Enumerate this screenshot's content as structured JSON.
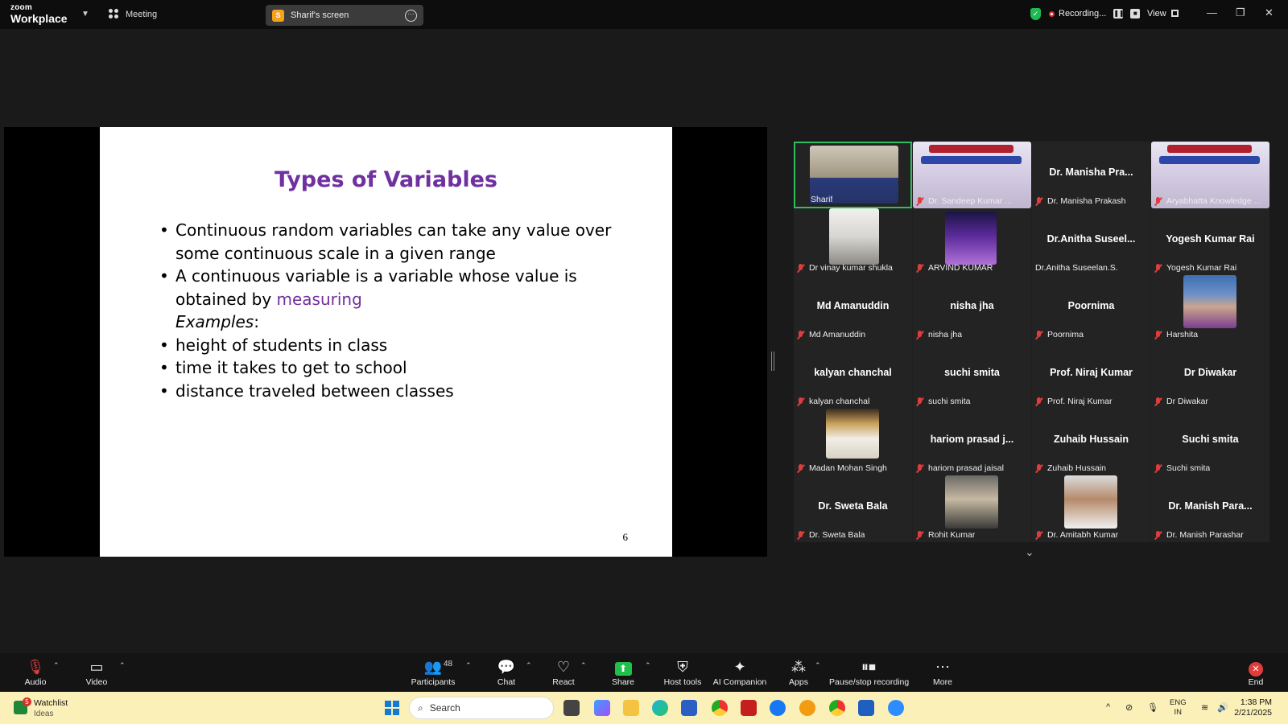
{
  "app": {
    "brand_top": "zoom",
    "brand_bottom": "Workplace",
    "meeting_label": "Meeting",
    "share_letter": "S",
    "share_title": "Sharif's screen",
    "recording_label": "Recording...",
    "view_label": "View"
  },
  "slide": {
    "title": "Types of Variables",
    "line1": "Continuous random variables can take any value over some continuous scale in a given range",
    "line2_prefix": "A continuous variable is a variable whose value is obtained by",
    "line2_highlight": "measuring",
    "examples_label": "Examples",
    "examples_colon": ":",
    "example1": "height of students in class",
    "example2": "time it takes to get to school",
    "example3": "distance traveled between classes",
    "page_number": "6"
  },
  "gallery": {
    "tiles": [
      {
        "label": "Sharif"
      },
      {
        "label": "Dr. Sandeep Kumar ..."
      },
      {
        "name": "Dr. Manisha Pra...",
        "label": "Dr. Manisha Prakash"
      },
      {
        "label": "Aryabhatta Knowledge ..."
      },
      {
        "label": "Dr vinay kumar shukla"
      },
      {
        "label": "ARVIND KUMAR"
      },
      {
        "name": "Dr.Anitha Suseel...",
        "label": "Dr.Anitha Suseelan.S."
      },
      {
        "name": "Yogesh Kumar Rai",
        "label": "Yogesh Kumar Rai"
      },
      {
        "name": "Md Amanuddin",
        "label": "Md Amanuddin"
      },
      {
        "name": "nisha jha",
        "label": "nisha jha"
      },
      {
        "name": "Poornima",
        "label": "Poornima"
      },
      {
        "label": "Harshita"
      },
      {
        "name": "kalyan chanchal",
        "label": "kalyan chanchal"
      },
      {
        "name": "suchi smita",
        "label": "suchi smita"
      },
      {
        "name": "Prof. Niraj Kumar",
        "label": "Prof. Niraj Kumar"
      },
      {
        "name": "Dr Diwakar",
        "label": "Dr Diwakar"
      },
      {
        "label": "Madan Mohan Singh"
      },
      {
        "name": "hariom prasad j...",
        "label": "hariom prasad jaisal"
      },
      {
        "name": "Zuhaib Hussain",
        "label": "Zuhaib Hussain"
      },
      {
        "name": "Suchi smita",
        "label": "Suchi smita"
      },
      {
        "name": "Dr. Sweta Bala",
        "label": "Dr. Sweta Bala"
      },
      {
        "label": "Rohit Kumar"
      },
      {
        "label": "Dr. Amitabh Kumar"
      },
      {
        "name": "Dr. Manish Para...",
        "label": "Dr. Manish Parashar"
      }
    ]
  },
  "toolbar": {
    "audio": "Audio",
    "video": "Video",
    "participants": "Participants",
    "participant_count": "48",
    "chat": "Chat",
    "react": "React",
    "share": "Share",
    "host_tools": "Host tools",
    "ai_companion": "AI Companion",
    "apps": "Apps",
    "pause_stop": "Pause/stop recording",
    "more": "More",
    "end": "End"
  },
  "taskbar": {
    "badge": "5",
    "watchlist": "Watchlist",
    "ideas": "Ideas",
    "search_placeholder": "Search",
    "lang1": "ENG",
    "lang2": "IN",
    "time": "1:38 PM",
    "date": "2/21/2025"
  },
  "colors": {
    "slide_title": "#7030a0",
    "active_speaker_border": "#2ebf5e",
    "share_button": "#1fbf4a",
    "end_button": "#e03c3c",
    "taskbar_bg": "#faf0b8"
  }
}
